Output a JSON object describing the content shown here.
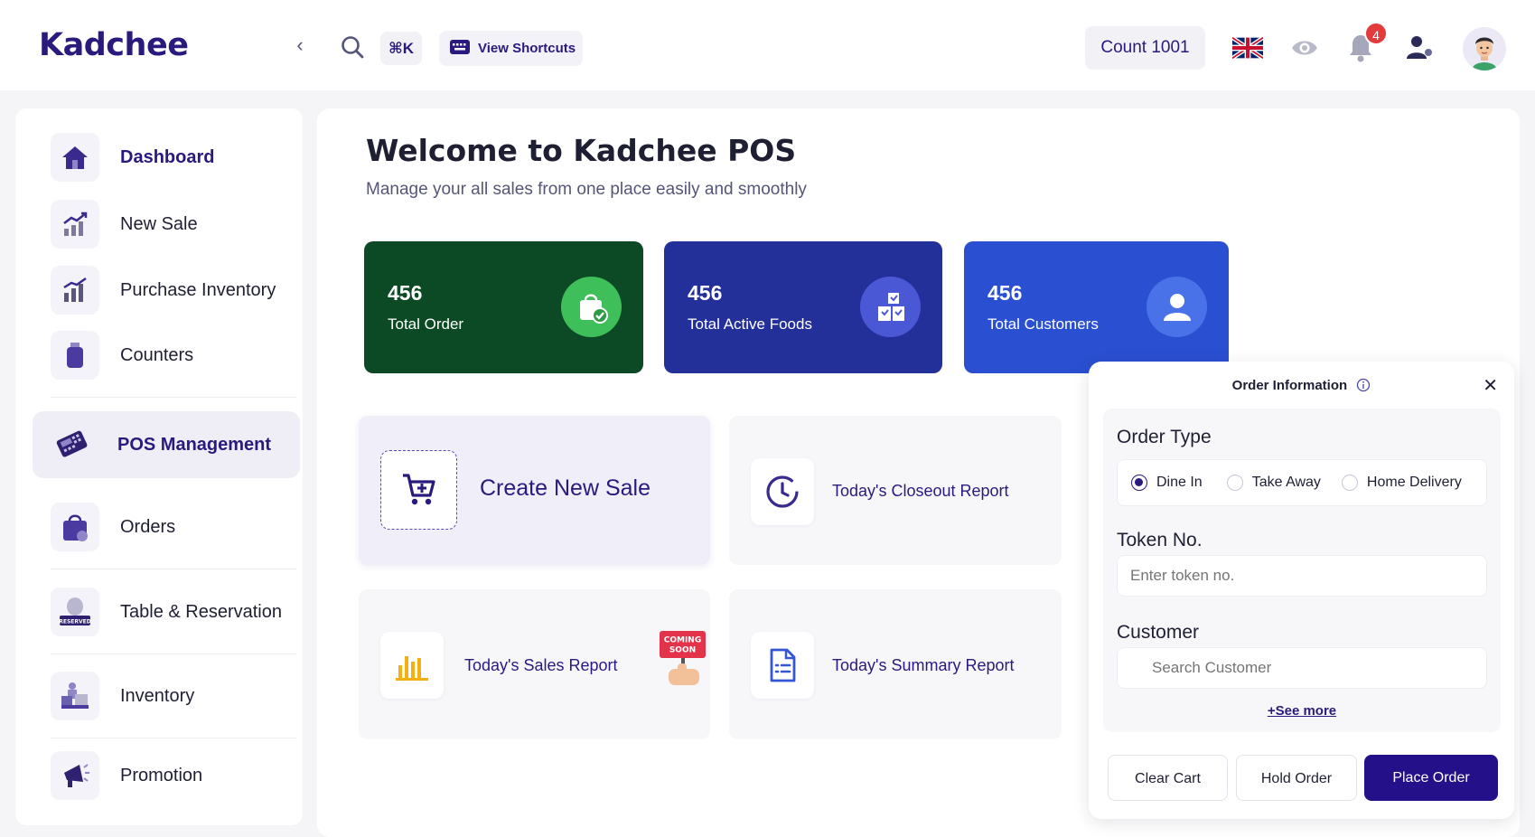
{
  "header": {
    "logo": "Kadchee",
    "search_shortcut": "⌘K",
    "shortcuts_label": "View Shortcuts",
    "count_label": "Count 1001",
    "notification_count": "4"
  },
  "sidebar": {
    "items": [
      {
        "label": "Dashboard",
        "icon": "home-icon"
      },
      {
        "label": "New Sale",
        "icon": "chart-up-icon"
      },
      {
        "label": "Purchase Inventory",
        "icon": "chart-bars-icon"
      },
      {
        "label": "Counters",
        "icon": "bottle-icon"
      },
      {
        "label": "POS Management",
        "icon": "pos-terminal-icon"
      },
      {
        "label": "Orders",
        "icon": "shopping-bag-icon"
      },
      {
        "label": "Table & Reservation",
        "icon": "reserved-icon"
      },
      {
        "label": "Inventory",
        "icon": "boxes-icon"
      },
      {
        "label": "Promotion",
        "icon": "megaphone-icon"
      }
    ]
  },
  "main": {
    "title": "Welcome to Kadchee POS",
    "subtitle": "Manage your all sales from one place easily and smoothly",
    "stats": [
      {
        "value": "456",
        "label": "Total Order",
        "color": "#0b4a24",
        "accent": "#3fbf5a"
      },
      {
        "value": "456",
        "label": "Total Active Foods",
        "color": "#24309a",
        "accent": "#4a58d6"
      },
      {
        "value": "456",
        "label": "Total Customers",
        "color": "#2a4fd0",
        "accent": "#4a72e8"
      }
    ],
    "actions": {
      "create_sale": "Create New Sale",
      "closeout_report": "Today's Closeout Report",
      "sales_report": "Today's Sales Report",
      "summary_report": "Today's Summary Report",
      "coming_soon_line1": "COMING",
      "coming_soon_line2": "SOON"
    }
  },
  "order_panel": {
    "title": "Order Information",
    "order_type_heading": "Order Type",
    "order_types": [
      "Dine In",
      "Take Away",
      "Home Delivery"
    ],
    "selected_order_type": "Dine In",
    "token_heading": "Token No.",
    "token_placeholder": "Enter token no.",
    "customer_heading": "Customer",
    "customer_placeholder": "Search Customer",
    "see_more": "+See more",
    "buttons": {
      "clear": "Clear Cart",
      "hold": "Hold Order",
      "place": "Place Order"
    }
  }
}
